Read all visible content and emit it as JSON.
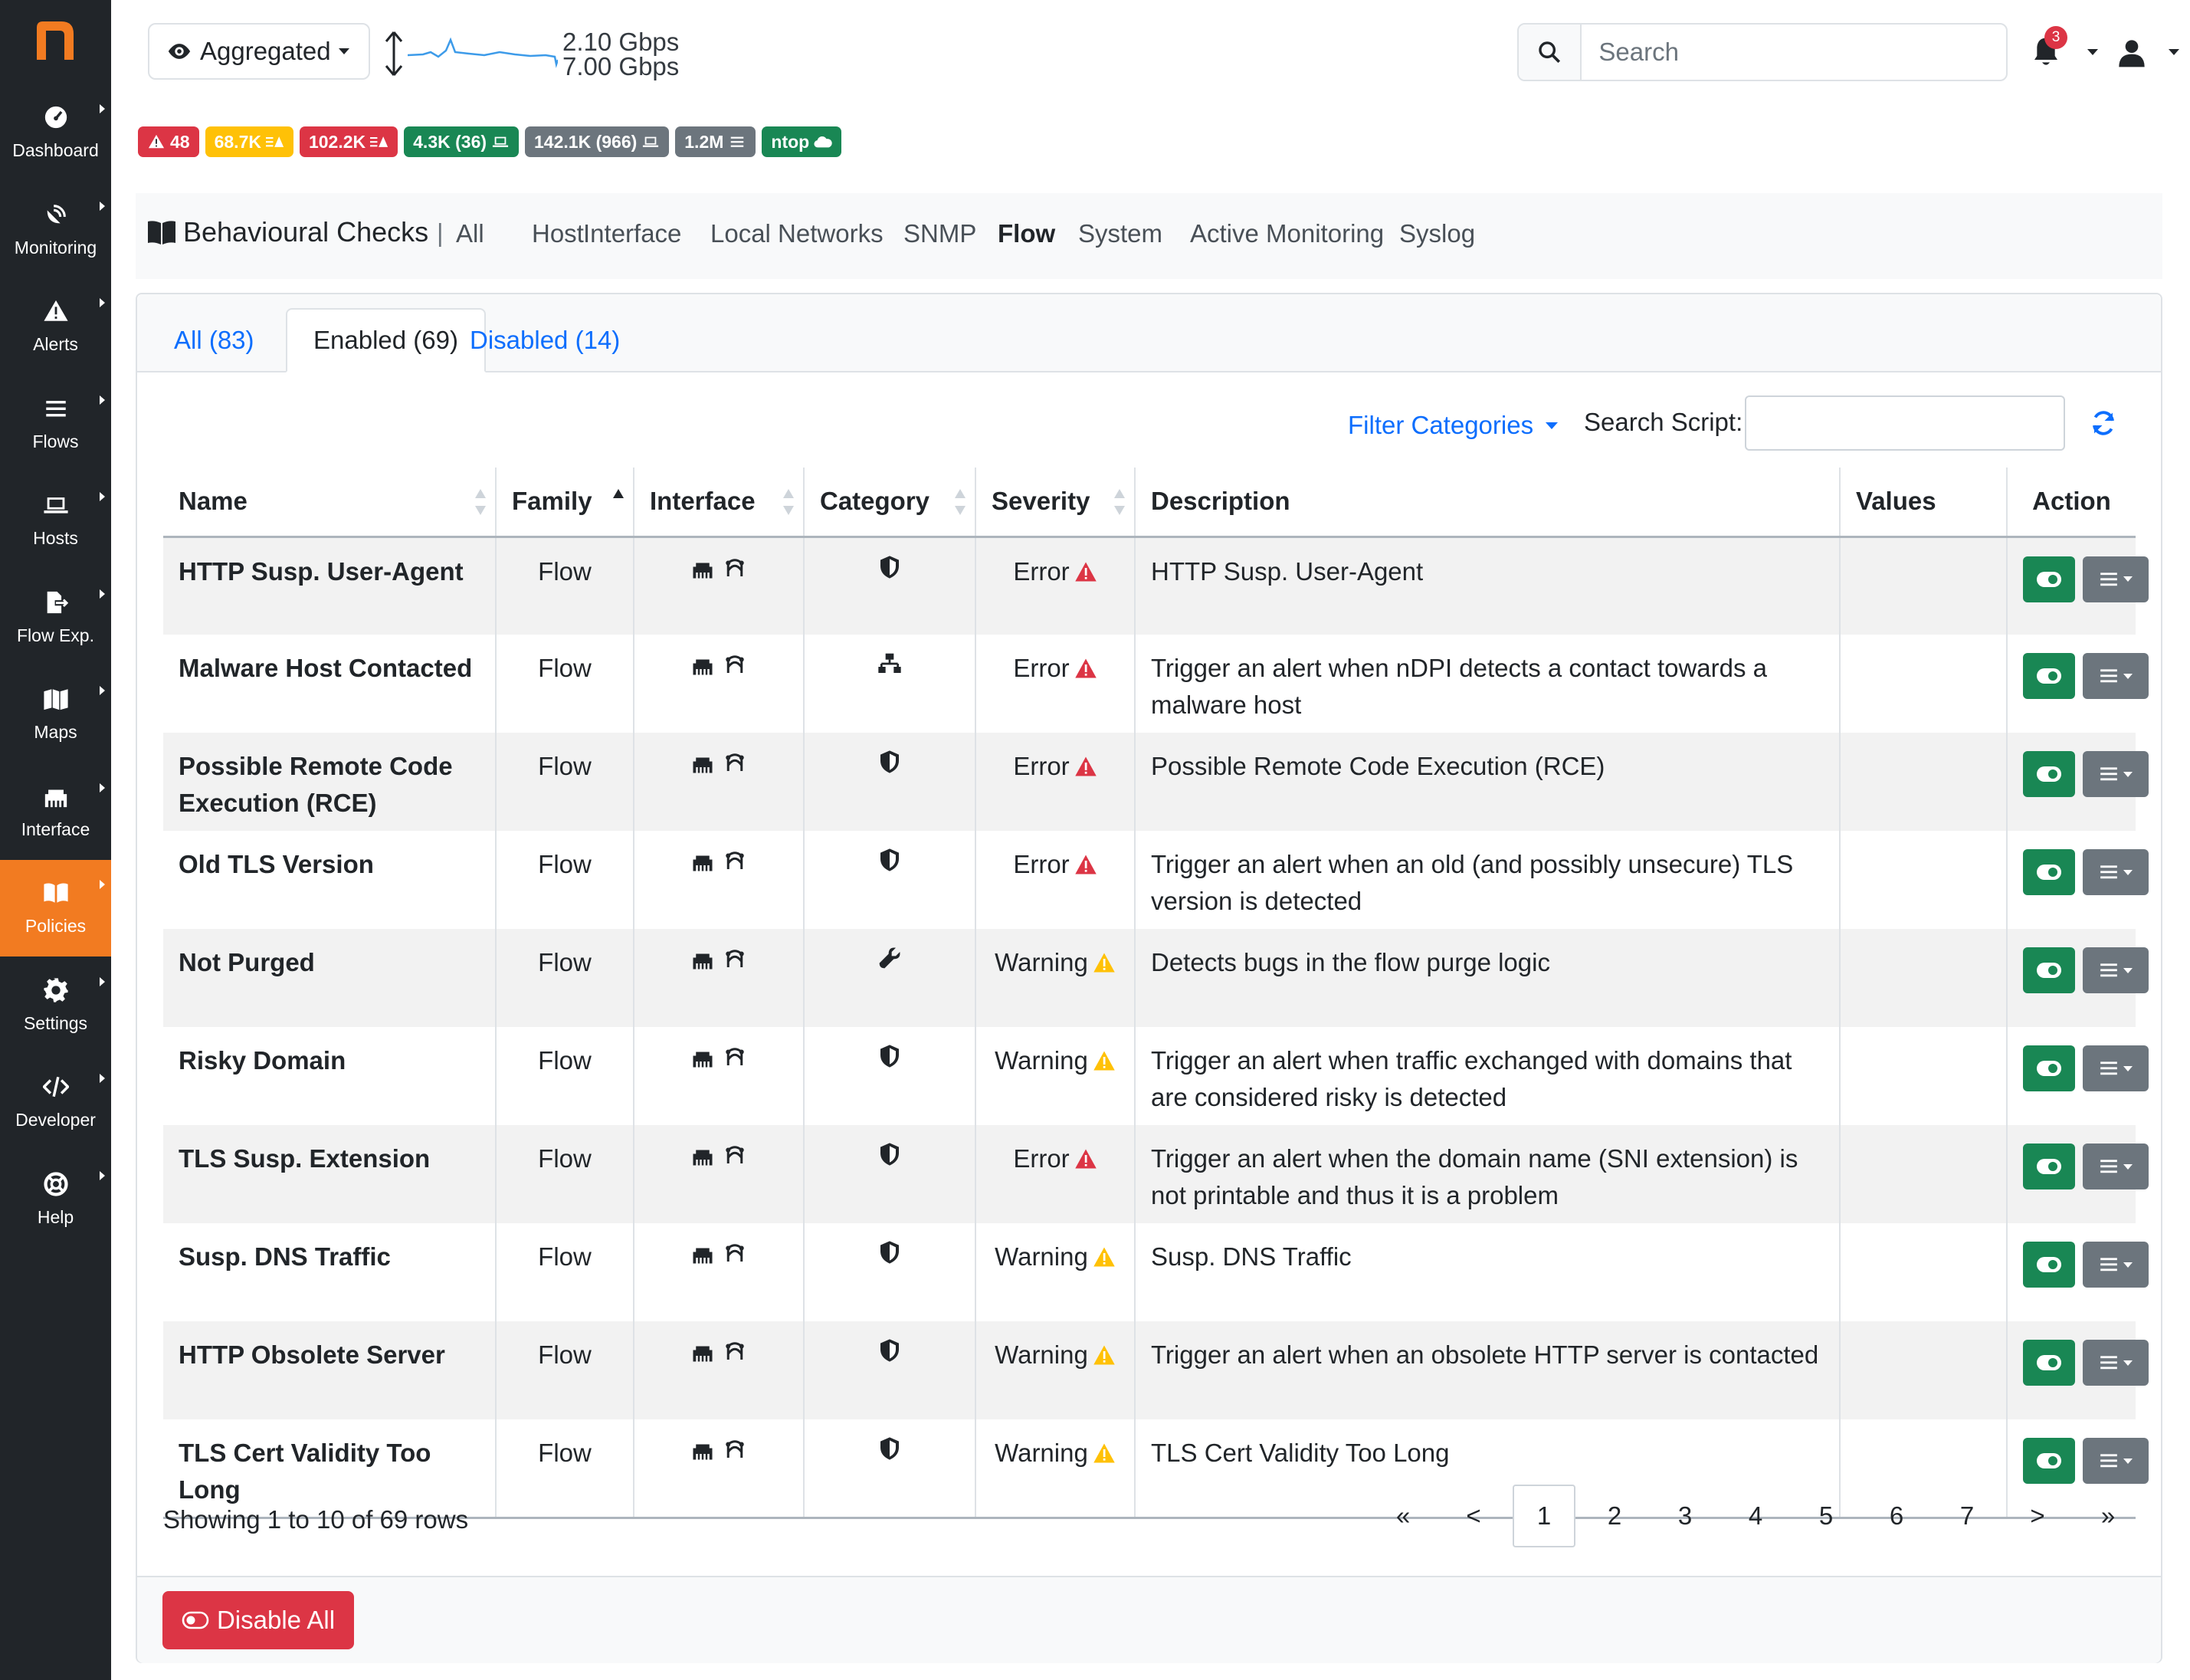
{
  "sidebar": {
    "logo": "n",
    "items": [
      {
        "label": "Dashboard",
        "icon": "gauge-icon"
      },
      {
        "label": "Monitoring",
        "icon": "satellite-dish-icon"
      },
      {
        "label": "Alerts",
        "icon": "warning-icon"
      },
      {
        "label": "Flows",
        "icon": "list-icon"
      },
      {
        "label": "Hosts",
        "icon": "laptop-icon"
      },
      {
        "label": "Flow Exp.",
        "icon": "file-export-icon"
      },
      {
        "label": "Maps",
        "icon": "map-icon"
      },
      {
        "label": "Interface",
        "icon": "ethernet-icon"
      },
      {
        "label": "Policies",
        "icon": "book-icon",
        "active": true
      },
      {
        "label": "Settings",
        "icon": "gear-icon"
      },
      {
        "label": "Developer",
        "icon": "code-icon"
      },
      {
        "label": "Help",
        "icon": "life-ring-icon"
      }
    ],
    "active_color": "#f27b21"
  },
  "topbar": {
    "interface_select": "Aggregated",
    "throughput_up": "2.10 Gbps",
    "throughput_down": "7.00 Gbps",
    "search_placeholder": "Search",
    "notifications_count": "3"
  },
  "badges": [
    {
      "text": "48",
      "color": "#dc3545",
      "icon": "warning-icon"
    },
    {
      "text": "68.7K",
      "color": "#ffc107",
      "icon": "list-warning-icon"
    },
    {
      "text": "102.2K",
      "color": "#dc3545",
      "icon": "list-warning-icon"
    },
    {
      "text": "4.3K (36)",
      "color": "#198754",
      "icon": "laptop-icon"
    },
    {
      "text": "142.1K (966)",
      "color": "#6c757d",
      "icon": "laptop-icon"
    },
    {
      "text": "1.2M",
      "color": "#6c757d",
      "icon": "list-icon"
    },
    {
      "text": "ntop",
      "color": "#198754",
      "icon": "cloud-icon"
    }
  ],
  "pagenav": {
    "title": "Behavioural Checks",
    "separator": "|",
    "links": [
      "All",
      "Host",
      "Interface",
      "Local Networks",
      "SNMP",
      "Flow",
      "System",
      "Active Monitoring",
      "Syslog"
    ],
    "active": "Flow"
  },
  "tabs": [
    "All (83)",
    "Enabled (69)",
    "Disabled (14)"
  ],
  "active_tab": "Enabled (69)",
  "toolbar": {
    "filter_categories": "Filter Categories",
    "search_script_label": "Search Script:"
  },
  "table": {
    "headers": [
      "Name",
      "Family",
      "Interface",
      "Category",
      "Severity",
      "Description",
      "Values",
      "Action"
    ],
    "rows": [
      {
        "name": "HTTP Susp. User-Agent",
        "family": "Flow",
        "category_icon": "shield-icon",
        "severity": "Error",
        "description": "HTTP Susp. User-Agent",
        "values": ""
      },
      {
        "name": "Malware Host Contacted",
        "family": "Flow",
        "category_icon": "network-icon",
        "severity": "Error",
        "description": "Trigger an alert when nDPI detects a contact towards a malware host",
        "values": ""
      },
      {
        "name": "Possible Remote Code Execution (RCE)",
        "family": "Flow",
        "category_icon": "shield-icon",
        "severity": "Error",
        "description": "Possible Remote Code Execution (RCE)",
        "values": ""
      },
      {
        "name": "Old TLS Version",
        "family": "Flow",
        "category_icon": "shield-icon",
        "severity": "Error",
        "description": "Trigger an alert when an old (and possibly unsecure) TLS version is detected",
        "values": ""
      },
      {
        "name": "Not Purged",
        "family": "Flow",
        "category_icon": "wrench-icon",
        "severity": "Warning",
        "description": "Detects bugs in the flow purge logic",
        "values": ""
      },
      {
        "name": "Risky Domain",
        "family": "Flow",
        "category_icon": "shield-icon",
        "severity": "Warning",
        "description": "Trigger an alert when traffic exchanged with domains that are considered risky is detected",
        "values": ""
      },
      {
        "name": "TLS Susp. Extension",
        "family": "Flow",
        "category_icon": "shield-icon",
        "severity": "Error",
        "description": "Trigger an alert when the domain name (SNI extension) is not printable and thus it is a problem",
        "values": ""
      },
      {
        "name": "Susp. DNS Traffic",
        "family": "Flow",
        "category_icon": "shield-icon",
        "severity": "Warning",
        "description": "Susp. DNS Traffic",
        "values": ""
      },
      {
        "name": "HTTP Obsolete Server",
        "family": "Flow",
        "category_icon": "shield-icon",
        "severity": "Warning",
        "description": "Trigger an alert when an obsolete HTTP server is contacted",
        "values": ""
      },
      {
        "name": "TLS Cert Validity Too Long",
        "family": "Flow",
        "category_icon": "shield-icon",
        "severity": "Warning",
        "description": "TLS Cert Validity Too Long",
        "values": ""
      }
    ],
    "severity_colors": {
      "Error": "#dc3545",
      "Warning": "#ffc107"
    }
  },
  "pagination": {
    "showing": "Showing 1 to 10 of 69 rows",
    "pages": [
      "«",
      "<",
      "1",
      "2",
      "3",
      "4",
      "5",
      "6",
      "7",
      ">",
      "»"
    ],
    "current": "1"
  },
  "footer": {
    "disable_all": "Disable All"
  }
}
